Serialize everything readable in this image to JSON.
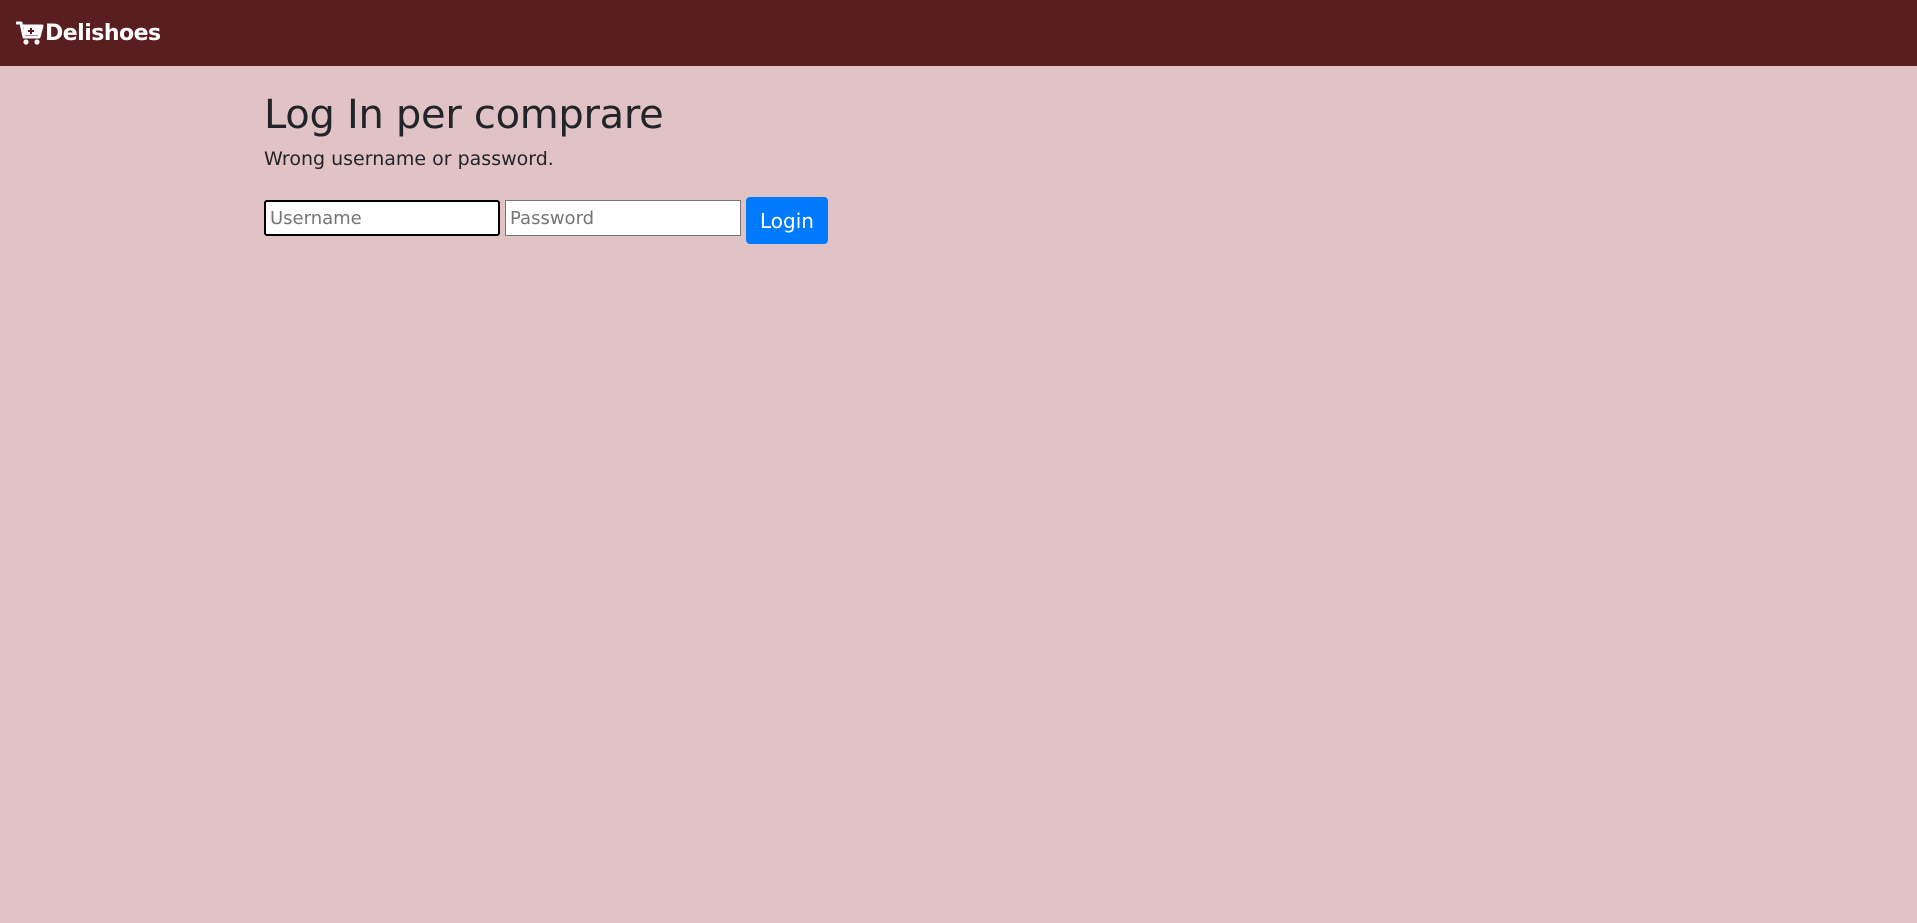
{
  "navbar": {
    "brand_label": "Delishoes",
    "brand_icon": "shopping-cart-icon"
  },
  "main": {
    "title": "Log In per comprare",
    "error_message": "Wrong username or password.",
    "form": {
      "username_placeholder": "Username",
      "username_value": "",
      "password_placeholder": "Password",
      "password_value": "",
      "submit_label": "Login"
    }
  },
  "colors": {
    "navbar_bg": "#5a1e20",
    "page_bg": "#e1c3c5",
    "primary_button": "#007bff",
    "text": "#212529"
  }
}
